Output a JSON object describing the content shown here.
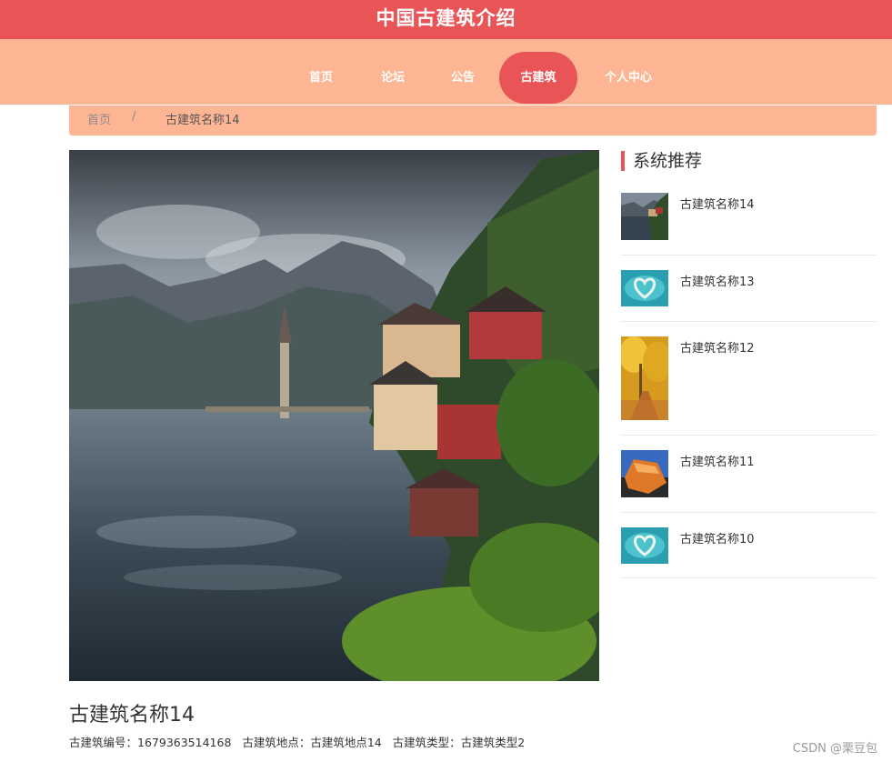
{
  "site": {
    "title": "中国古建筑介绍"
  },
  "nav": {
    "items": [
      {
        "label": "首页"
      },
      {
        "label": "论坛"
      },
      {
        "label": "公告"
      },
      {
        "label": "古建筑",
        "active": true
      },
      {
        "label": "个人中心"
      }
    ],
    "active_color": "#e95557",
    "bar_color": "#fdb593"
  },
  "breadcrumb": {
    "home": "首页",
    "separator": "/",
    "current": "古建筑名称14"
  },
  "detail": {
    "image_icon": "lakeside-village-photo",
    "title": "古建筑名称14",
    "number_label": "古建筑编号：",
    "number_value": "1679363514168",
    "location_label": "古建筑地点：",
    "location_value": "古建筑地点14",
    "type_label": "古建筑类型：",
    "type_value": "古建筑类型2"
  },
  "sidebar": {
    "heading": "系统推荐",
    "items": [
      {
        "name": "古建筑名称14",
        "thumb": "lakeside-village-thumb"
      },
      {
        "name": "古建筑名称13",
        "thumb": "heart-island-thumb"
      },
      {
        "name": "古建筑名称12",
        "thumb": "autumn-path-thumb"
      },
      {
        "name": "古建筑名称11",
        "thumb": "orange-rock-thumb"
      },
      {
        "name": "古建筑名称10",
        "thumb": "heart-island-thumb"
      }
    ]
  },
  "watermark": "CSDN @栗豆包"
}
